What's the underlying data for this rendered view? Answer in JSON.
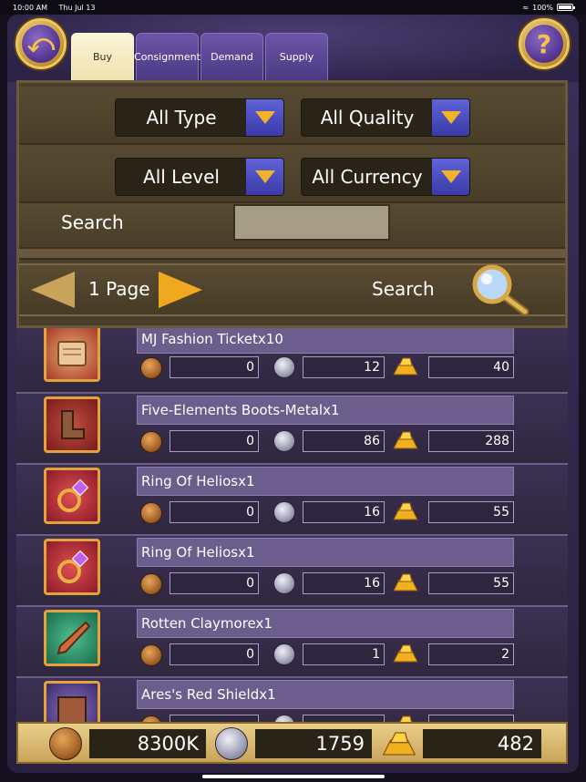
{
  "status_bar": {
    "time": "10:00 AM",
    "date": "Thu Jul 13",
    "battery": "100%"
  },
  "tabs": [
    {
      "label": "Buy",
      "active": true
    },
    {
      "label": "Consignment",
      "active": false
    },
    {
      "label": "Demand",
      "active": false
    },
    {
      "label": "Supply",
      "active": false
    }
  ],
  "filters": {
    "type": "All Type",
    "quality": "All Quality",
    "level": "All Level",
    "currency": "All Currency",
    "search_label": "Search",
    "search_value": ""
  },
  "pager": {
    "page_label": "1 Page",
    "search_label": "Search"
  },
  "items": [
    {
      "name": "MJ Fashion Ticketx10",
      "icon": "scroll-icon",
      "copper": "0",
      "silver": "12",
      "gold": "40"
    },
    {
      "name": "Five-Elements Boots-Metalx1",
      "icon": "boots-icon",
      "copper": "0",
      "silver": "86",
      "gold": "288"
    },
    {
      "name": "Ring Of Heliosx1",
      "icon": "ring-icon",
      "copper": "0",
      "silver": "16",
      "gold": "55"
    },
    {
      "name": "Ring Of Heliosx1",
      "icon": "ring-icon",
      "copper": "0",
      "silver": "16",
      "gold": "55"
    },
    {
      "name": "Rotten Claymorex1",
      "icon": "sword-icon",
      "copper": "0",
      "silver": "1",
      "gold": "2"
    },
    {
      "name": "Ares's Red Shieldx1",
      "icon": "shield-icon",
      "copper": "",
      "silver": "",
      "gold": ""
    }
  ],
  "wallet": {
    "copper": "8300K",
    "silver": "1759",
    "gold": "482"
  }
}
